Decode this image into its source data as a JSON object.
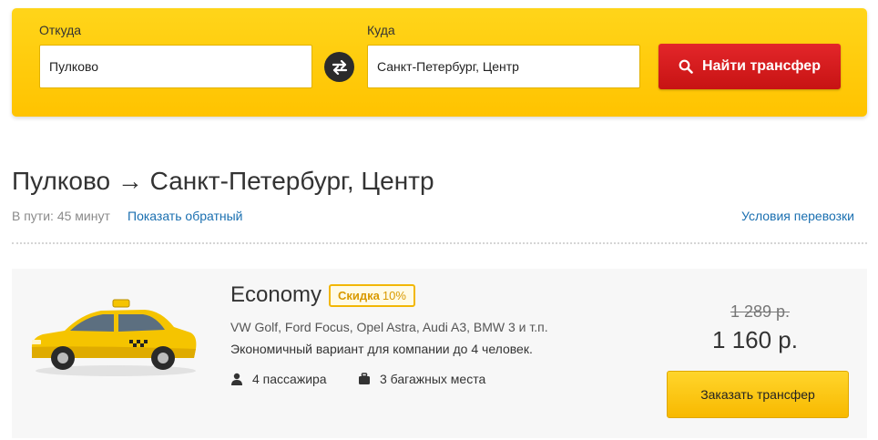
{
  "search": {
    "from_label": "Откуда",
    "from_value": "Пулково",
    "to_label": "Куда",
    "to_value": "Санкт-Петербург, Центр",
    "find_button": "Найти трансфер"
  },
  "route": {
    "title": "Пулково → Санкт-Петербург, Центр",
    "travel_time": "В пути: 45 минут",
    "reverse_link": "Показать обратный",
    "terms_link": "Условия перевозки"
  },
  "offer": {
    "class_name": "Economy",
    "discount_prefix": "Скидка",
    "discount_value": "10%",
    "models": "VW Golf, Ford Focus, Opel Astra, Audi A3, BMW 3 и т.п.",
    "description": "Экономичный вариант для компании до 4 человек.",
    "passengers": "4 пассажира",
    "luggage": "3 багажных места",
    "old_price": "1 289 р.",
    "price": "1 160 р.",
    "order_button": "Заказать трансфер"
  },
  "colors": {
    "panel": "#ffc300",
    "find_button": "#d91c1c",
    "link": "#1a6fb0",
    "order_button": "#f8b900"
  },
  "icons": [
    "swap-icon",
    "search-icon",
    "person-icon",
    "luggage-icon",
    "taxi-car-image"
  ]
}
